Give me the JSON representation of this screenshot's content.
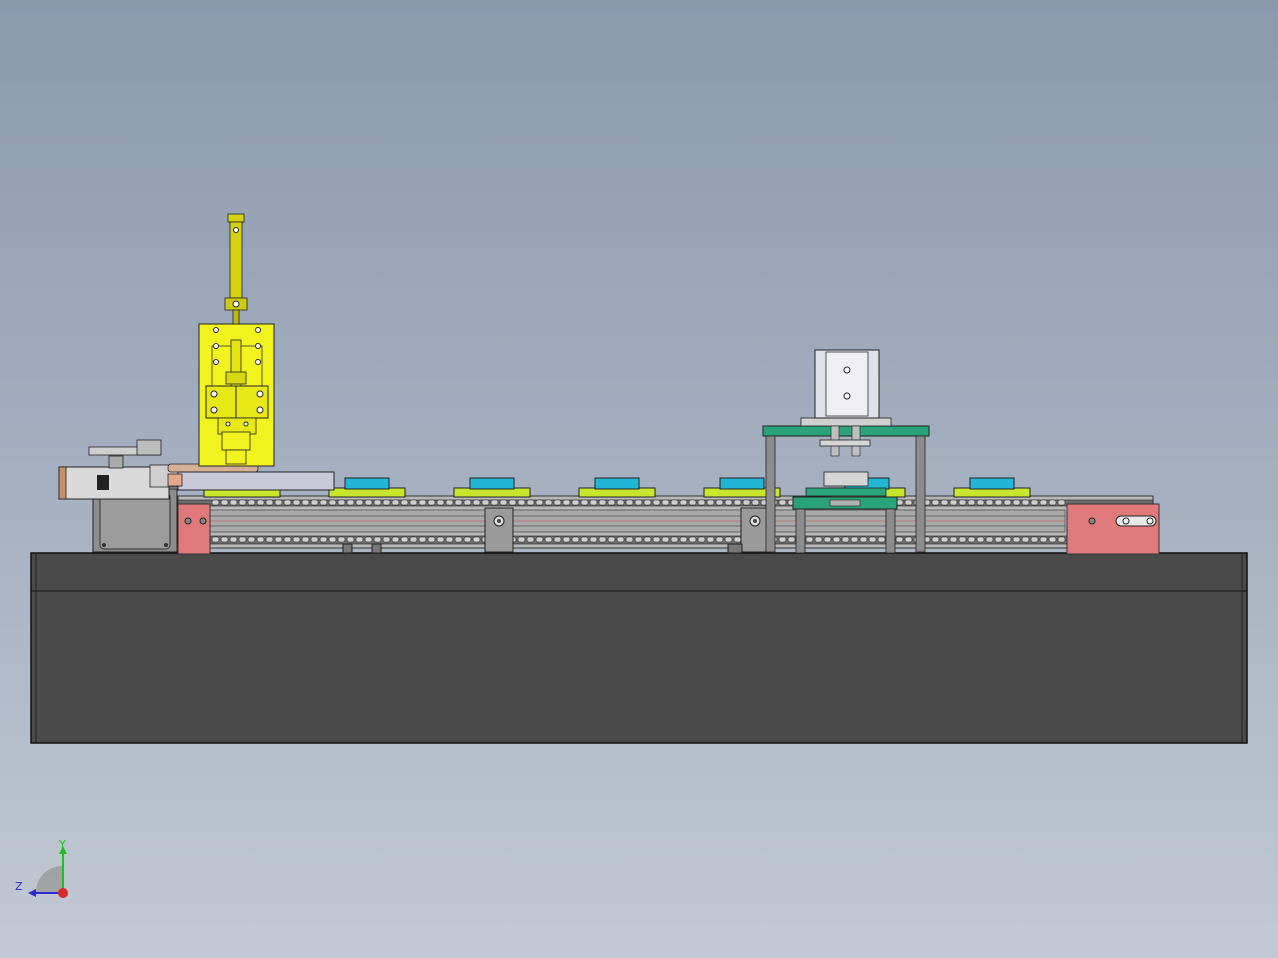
{
  "viewport": {
    "background_top": "#8a9aad",
    "background_bottom": "#c3c9d4"
  },
  "model": {
    "base_color": "#4a4a4a",
    "conveyor_frame_color": "#b8b8b8",
    "end_plate_color": "#e07a7a",
    "pallet_base_color": "#c8e62e",
    "pallet_part_color": "#23b5d6",
    "cylinder_color": "#d6d212",
    "mount_plate_color": "#f2f21e",
    "press_plate_color": "#2aa37b",
    "motor_color": "#8d8d8d",
    "pallet_count": 7
  },
  "triad": {
    "y_label": "Y",
    "z_label": "Z",
    "y_color": "#19c21c",
    "z_color": "#2a2ad0",
    "x_color": "#d62a2a"
  }
}
